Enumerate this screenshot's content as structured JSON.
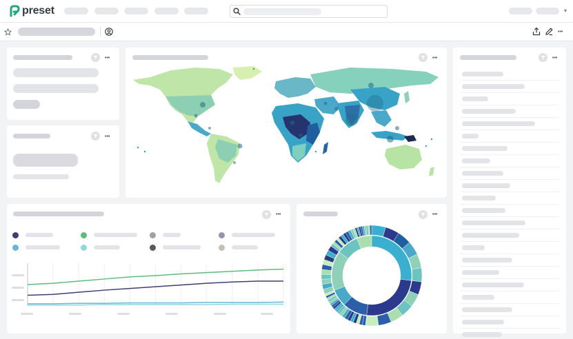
{
  "app": {
    "brand": "preset"
  },
  "colors": {
    "accent": "#20a779",
    "skeleton": "#e3e4e8",
    "series_green": "#5bbd7c",
    "series_navy": "#3b3f72",
    "series_blue": "#66b6d6",
    "series_teal": "#8fd8e0"
  },
  "icons": {
    "logo": "preset-logo-icon",
    "search": "search-icon",
    "favorite": "star-icon",
    "owner": "user-circle-icon",
    "share": "share-icon",
    "edit": "pencil-icon",
    "more": "ellipsis-icon",
    "filter": "filter-icon"
  },
  "header": {
    "more_glyph": "•••"
  },
  "charts": {
    "map": {
      "type": "world-map"
    },
    "line": {
      "type": "line",
      "series_colors": [
        "#5bbd7c",
        "#3b3f72",
        "#66b6d6",
        "#8fd8e0"
      ]
    },
    "donut": {
      "type": "sunburst"
    }
  },
  "chart_data": {
    "type": "line",
    "x": [
      0,
      1,
      2,
      3,
      4,
      5,
      6,
      7,
      8,
      9,
      10
    ],
    "series": [
      {
        "values": [
          0.5,
          0.53,
          0.58,
          0.63,
          0.68,
          0.71,
          0.75,
          0.78,
          0.81,
          0.84,
          0.86
        ]
      },
      {
        "values": [
          0.25,
          0.27,
          0.32,
          0.37,
          0.41,
          0.45,
          0.49,
          0.53,
          0.56,
          0.58,
          0.58
        ]
      },
      {
        "values": [
          0.05,
          0.05,
          0.06,
          0.06,
          0.07,
          0.07,
          0.07,
          0.08,
          0.08,
          0.08,
          0.09
        ]
      },
      {
        "values": [
          0.02,
          0.02,
          0.02,
          0.03,
          0.03,
          0.03,
          0.03,
          0.03,
          0.04,
          0.04,
          0.04
        ]
      }
    ],
    "grid": true
  }
}
